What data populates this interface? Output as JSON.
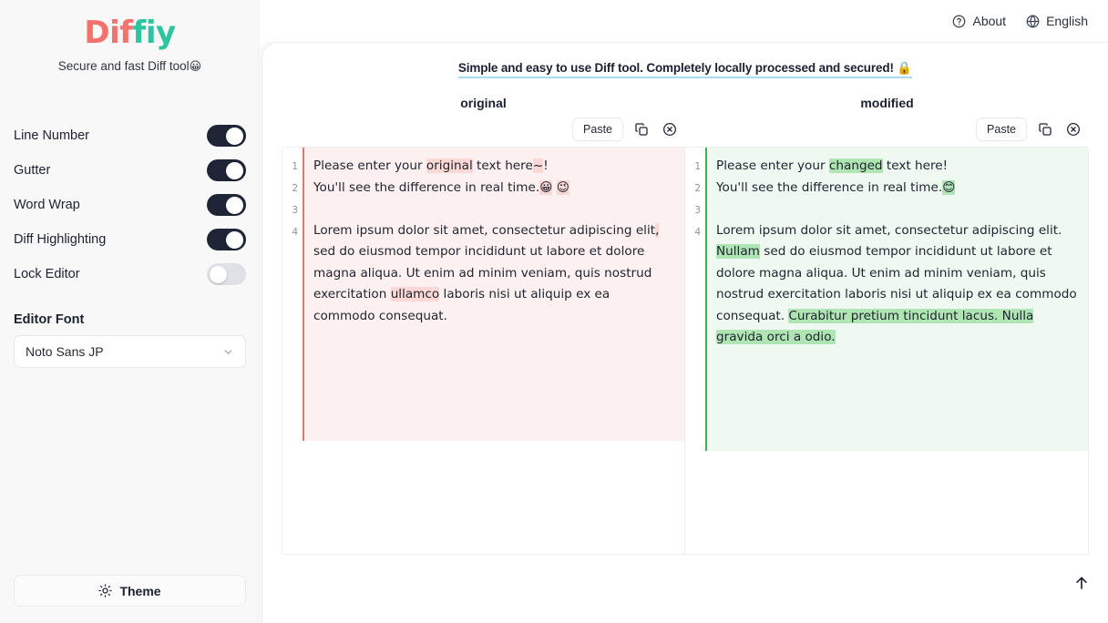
{
  "brand": {
    "logo_part_a": "Dif",
    "logo_part_b": "fiy",
    "tagline": "Secure and fast Diff tool",
    "tagline_emoji": "😀",
    "color_a": "#f4726d",
    "color_b": "#2ec4a0"
  },
  "topnav": {
    "about_label": "About",
    "language_label": "English",
    "about_icon": "question-circle-icon",
    "language_icon": "globe-icon"
  },
  "sidebar": {
    "settings": [
      {
        "label": "Line Number",
        "state": "on"
      },
      {
        "label": "Gutter",
        "state": "on"
      },
      {
        "label": "Word Wrap",
        "state": "on"
      },
      {
        "label": "Diff Highlighting",
        "state": "on"
      },
      {
        "label": "Lock Editor",
        "state": "off"
      }
    ],
    "editor_font": {
      "label": "Editor Font",
      "value": "Noto Sans JP",
      "chevron_icon": "chevron-down-icon"
    },
    "theme_button": {
      "label": "Theme",
      "icon": "sun-icon"
    }
  },
  "main": {
    "headline": "Simple and easy to use Diff tool. Completely locally processed and secured! 🔒",
    "headline_underline_color": "#a9dcf0",
    "panes": [
      {
        "title": "original",
        "toolbar": {
          "paste_label": "Paste",
          "copy_icon": "copy-icon",
          "clear_icon": "clear-circle-x-icon"
        },
        "accent_color": "#e8756f",
        "background_color": "#fdf0f0",
        "highlight_color": "#fbd8d5",
        "line_numbers": [
          "1",
          "2",
          "3",
          "4"
        ],
        "lines": [
          [
            {
              "t": "Please enter your ",
              "h": false
            },
            {
              "t": "original",
              "h": true
            },
            {
              "t": " text here",
              "h": false
            },
            {
              "t": "~",
              "h": true
            },
            {
              "t": "!",
              "h": false
            }
          ],
          [
            {
              "t": "You'll see the difference in real time.",
              "h": false
            },
            {
              "t": "😀",
              "h": true
            },
            {
              "t": " ",
              "h": false
            },
            {
              "t": "😉",
              "h": true
            }
          ],
          [],
          [
            {
              "t": "Lorem ipsum dolor sit amet, consectetur adipiscing elit",
              "h": false
            },
            {
              "t": ",",
              "h": true
            },
            {
              "t": " sed do eiusmod tempor incididunt ut labore et dolore magna aliqua. Ut enim ad minim veniam, quis nostrud exercitation ",
              "h": false
            },
            {
              "t": "ullamco",
              "h": true
            },
            {
              "t": " laboris nisi ut aliquip ex ea commodo consequat.",
              "h": false
            }
          ]
        ]
      },
      {
        "title": "modified",
        "toolbar": {
          "paste_label": "Paste",
          "copy_icon": "copy-icon",
          "clear_icon": "clear-circle-x-icon"
        },
        "accent_color": "#3cb34e",
        "background_color": "#eff8f1",
        "highlight_color": "#aee5b3",
        "line_numbers": [
          "1",
          "2",
          "3",
          "4"
        ],
        "lines": [
          [
            {
              "t": "Please enter your ",
              "h": false
            },
            {
              "t": "changed",
              "h": true
            },
            {
              "t": " text here!",
              "h": false
            }
          ],
          [
            {
              "t": "You'll see the difference in real time.",
              "h": false
            },
            {
              "t": "😊",
              "h": true
            }
          ],
          [],
          [
            {
              "t": "Lorem ipsum dolor sit amet, consectetur adipiscing elit.",
              "h": false
            },
            {
              "t": " Nullam",
              "h": true
            },
            {
              "t": " sed do eiusmod tempor incididunt ut labore et dolore magna aliqua. Ut enim ad minim veniam, quis nostrud exercitation laboris nisi ut aliquip ex ea commodo consequat. ",
              "h": false
            },
            {
              "t": "Curabitur pretium tincidunt lacus. Nulla gravida orci a odio.",
              "h": true
            }
          ]
        ]
      }
    ],
    "scroll_top_icon": "arrow-up-icon"
  }
}
